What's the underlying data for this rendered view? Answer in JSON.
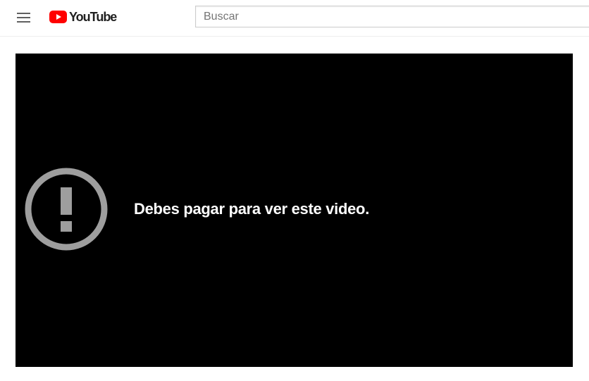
{
  "header": {
    "menu_icon": "hamburger-menu-icon",
    "logo_text": "YouTube",
    "logo_icon": "youtube-play-icon",
    "brand_color": "#ff0000",
    "search": {
      "placeholder": "Buscar",
      "value": ""
    }
  },
  "player": {
    "background_color": "#000000",
    "error_icon": "exclamation-circle-icon",
    "error_icon_color": "#9e9e9e",
    "error_message": "Debes pagar para ver este video."
  }
}
